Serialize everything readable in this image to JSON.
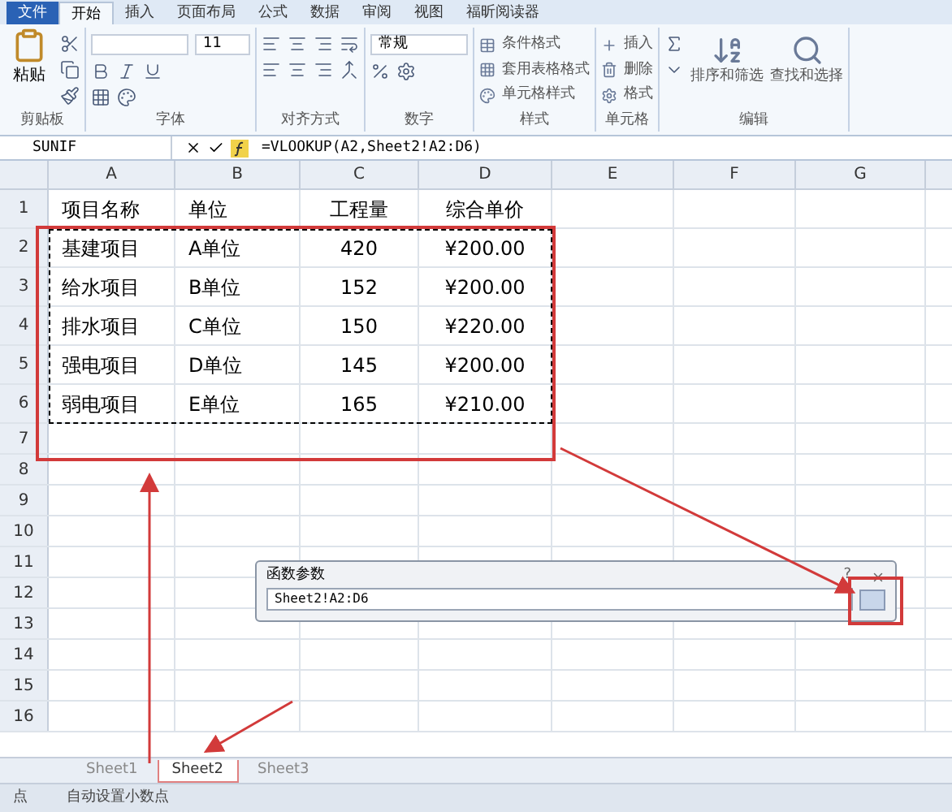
{
  "ribbon": {
    "tabs": [
      {
        "label": "文件",
        "selected": false
      },
      {
        "label": "开始",
        "selected": true
      },
      {
        "label": "插入",
        "selected": false
      },
      {
        "label": "页面布局",
        "selected": false
      },
      {
        "label": "公式",
        "selected": false
      },
      {
        "label": "数据",
        "selected": false
      },
      {
        "label": "审阅",
        "selected": false
      },
      {
        "label": "视图",
        "selected": false
      },
      {
        "label": "福昕阅读器",
        "selected": false
      }
    ],
    "groups": [
      {
        "kind": "clipboard",
        "label": "剪贴板",
        "buttons": [
          "粘贴"
        ]
      },
      {
        "kind": "font",
        "label": "字体",
        "font_size": "11"
      },
      {
        "kind": "align",
        "label": "对齐方式"
      },
      {
        "kind": "number",
        "label": "数字",
        "format": "常规"
      },
      {
        "kind": "styles",
        "label": "样式",
        "buttons": [
          "条件格式",
          "套用表格格式",
          "单元格样式"
        ]
      },
      {
        "kind": "cells",
        "label": "单元格",
        "buttons": [
          "插入",
          "删除",
          "格式"
        ]
      },
      {
        "kind": "editing",
        "label": "编辑",
        "buttons": [
          "排序和筛选",
          "查找和选择"
        ]
      }
    ]
  },
  "formula_bar": {
    "name_box": "SUNIF",
    "formula": "=VLOOKUP(A2,Sheet2!A2:D6)"
  },
  "sheet": {
    "columns": [
      "A",
      "B",
      "C",
      "D",
      "E",
      "F",
      "G"
    ],
    "rows": [
      {
        "header": "1",
        "cells": [
          "项目名称",
          "单位",
          "工程量",
          "综合单价"
        ]
      },
      {
        "header": "2",
        "cells": [
          "基建项目",
          "A单位",
          "420",
          "¥200.00"
        ]
      },
      {
        "header": "3",
        "cells": [
          "给水项目",
          "B单位",
          "152",
          "¥200.00"
        ]
      },
      {
        "header": "4",
        "cells": [
          "排水项目",
          "C单位",
          "150",
          "¥220.00"
        ]
      },
      {
        "header": "5",
        "cells": [
          "强电项目",
          "D单位",
          "145",
          "¥200.00"
        ]
      },
      {
        "header": "6",
        "cells": [
          "弱电项目",
          "E单位",
          "165",
          "¥210.00"
        ]
      },
      {
        "header": "7"
      },
      {
        "header": "8"
      },
      {
        "header": "9"
      },
      {
        "header": "10"
      },
      {
        "header": "11"
      },
      {
        "header": "12"
      },
      {
        "header": "13"
      },
      {
        "header": "14"
      },
      {
        "header": "15"
      },
      {
        "header": "16"
      }
    ]
  },
  "dialog": {
    "title": "函数参数",
    "value": "Sheet2!A2:D6",
    "help": "?"
  },
  "sheet_tabs": [
    {
      "label": "Sheet1",
      "selected": false
    },
    {
      "label": "Sheet2",
      "selected": true
    },
    {
      "label": "Sheet3",
      "selected": false
    }
  ],
  "status_bar": {
    "mode": "点",
    "message": "自动设置小数点"
  }
}
